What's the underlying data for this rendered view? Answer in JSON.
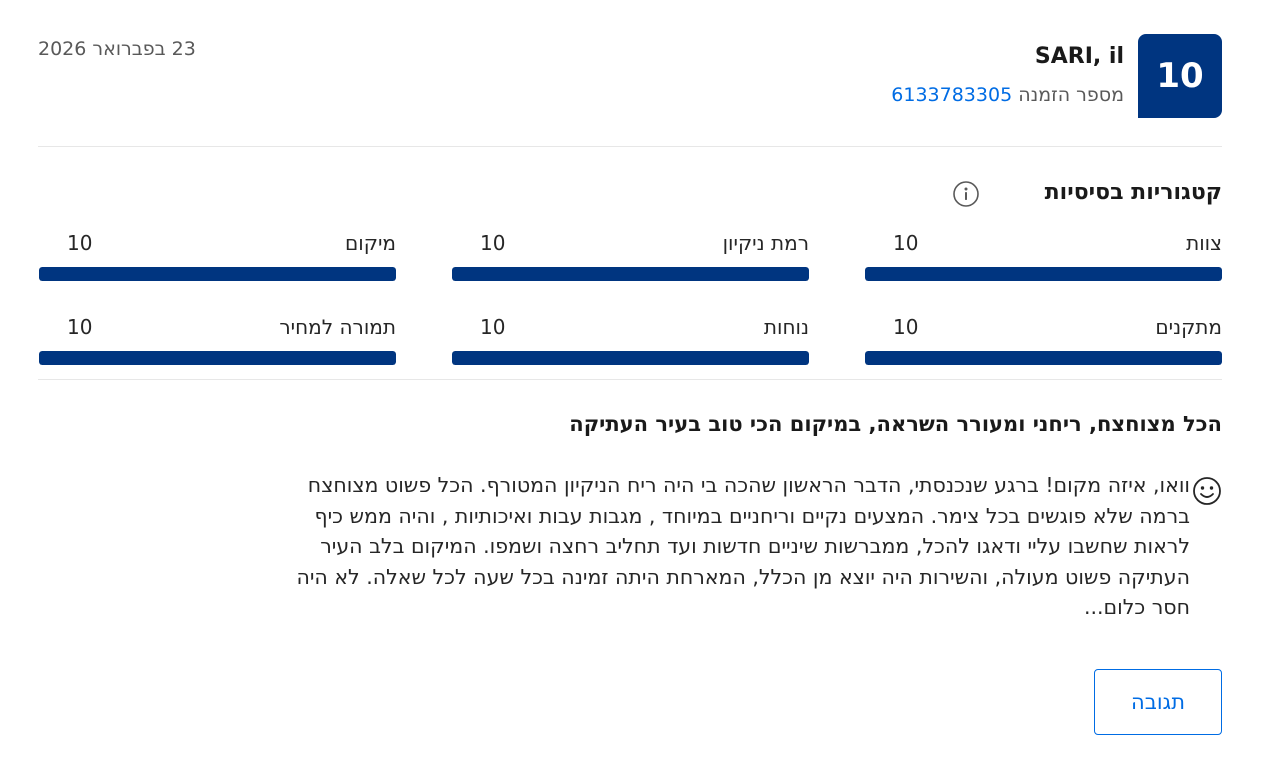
{
  "header": {
    "score": "10",
    "reviewer_name": "SARI, il",
    "booking_label": "מספר הזמנה",
    "booking_number": "6133783305",
    "date": "23 בפברואר 2026"
  },
  "categories": {
    "heading": "קטגוריות בסיסיות",
    "info_icon": "info-circle-icon",
    "items": [
      {
        "label": "צוות",
        "score": "10",
        "fraction": 1.0
      },
      {
        "label": "רמת ניקיון",
        "score": "10",
        "fraction": 1.0
      },
      {
        "label": "מיקום",
        "score": "10",
        "fraction": 1.0
      },
      {
        "label": "מתקנים",
        "score": "10",
        "fraction": 1.0
      },
      {
        "label": "נוחות",
        "score": "10",
        "fraction": 1.0
      },
      {
        "label": "תמורה למחיר",
        "score": "10",
        "fraction": 1.0
      }
    ]
  },
  "review": {
    "title": "הכל מצוחצח, ריחני ומעורר השראה, במיקום הכי טוב בעיר העתיקה",
    "positive_icon": "smiley-face-icon",
    "lines": [
      "וואו, איזה מקום! ברגע שנכנסתי, הדבר הראשון שהכה בי היה ריח הניקיון המטורף. הכל פשוט מצוחצח",
      "ברמה שלא פוגשים בכל צימר. המצעים נקיים וריחניים במיוחד , מגבות עבות ואיכותיות , והיה ממש כיף",
      "לראות שחשבו עליי ודאגו להכל, ממברשות שיניים חדשות ועד תחליב רחצה ושמפו. המיקום בלב העיר",
      "העתיקה פשוט מעולה, והשירות היה יוצא מן הכלל, המארחת היתה זמינה בכל שעה לכל שאלה. לא היה",
      "חסר כלום..."
    ]
  },
  "actions": {
    "reply_label": "תגובה"
  },
  "colors": {
    "brand_blue": "#003580",
    "link_blue": "#006ce4"
  }
}
